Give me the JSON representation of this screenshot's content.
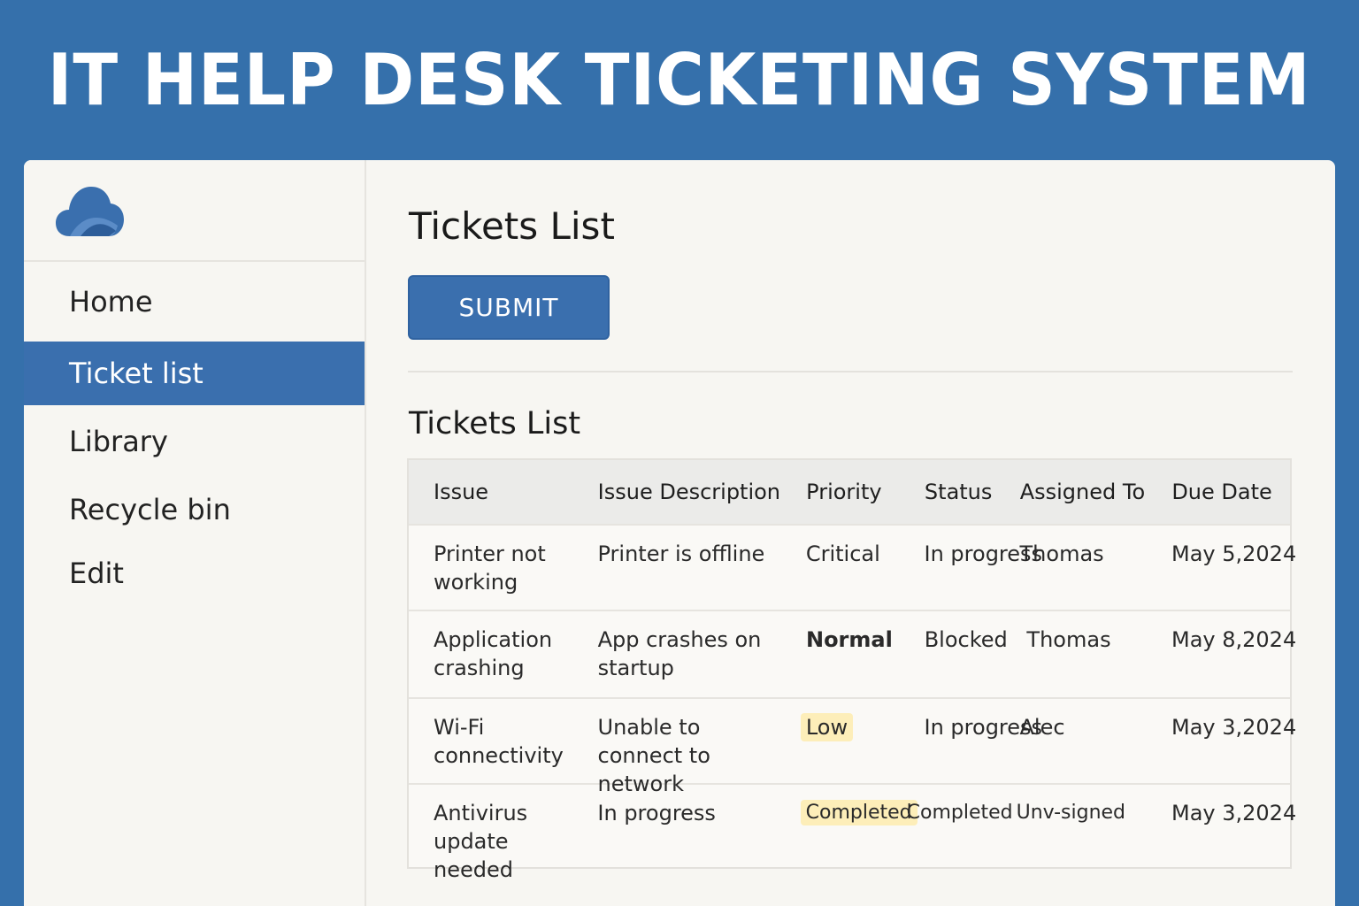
{
  "banner": {
    "title": "IT HELP DESK TICKETING SYSTEM"
  },
  "colors": {
    "brand": "#3570ab",
    "accent": "#3a6fae",
    "badge": "#fdeeb9"
  },
  "sidebar": {
    "logo_icon": "cloud-icon",
    "items": [
      {
        "label": "Home",
        "active": false
      },
      {
        "label": "Ticket list",
        "active": true
      },
      {
        "label": "Library",
        "active": false
      },
      {
        "label": "Recycle bin",
        "active": false
      },
      {
        "label": "Edit",
        "active": false
      }
    ]
  },
  "main": {
    "page_title": "Tickets List",
    "submit_label": "SUBMIT",
    "section_title": "Tickets List",
    "table": {
      "columns": [
        "Issue",
        "Issue Description",
        "Priority",
        "Status",
        "Assigned To",
        "Due Date"
      ],
      "rows": [
        {
          "issue": "Printer not working",
          "description": "Printer is offline",
          "priority": "Critical",
          "status": "In progress",
          "assigned": "Thomas",
          "due": "May 5,2024"
        },
        {
          "issue": "Application crashing",
          "description": "App crashes on startup",
          "priority": "Normal",
          "status": "Blocked",
          "assigned": "Thomas",
          "due": "May 8,2024"
        },
        {
          "issue": "Wi-Fi connectivity",
          "description": "Unable to connect to network",
          "priority": "Low",
          "status": "In progress",
          "assigned": "Alec",
          "due": "May 3,2024"
        },
        {
          "issue": "Antivirus update needed",
          "description": "In progress",
          "priority": "Completed",
          "status": "Completed",
          "assigned": "Unv-signed",
          "due": "May 3,2024"
        }
      ]
    }
  }
}
